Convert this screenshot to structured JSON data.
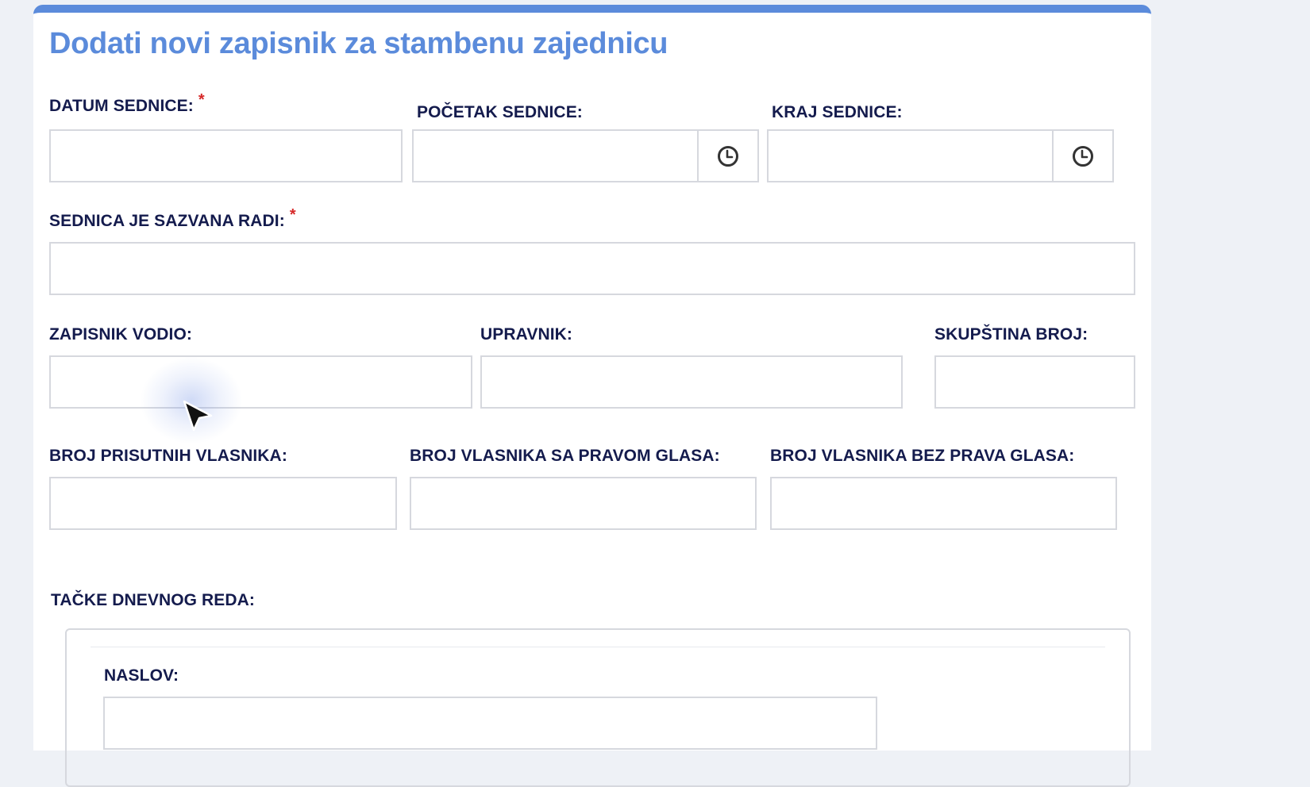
{
  "form": {
    "title": "Dodati novi zapisnik za stambenu zajednicu",
    "required_mark": "*",
    "fields": {
      "datum_sednice": {
        "label": "DATUM SEDNICE:",
        "value": ""
      },
      "pocetak_sednice": {
        "label": "POČETAK SEDNICE:",
        "value": ""
      },
      "kraj_sednice": {
        "label": "KRAJ SEDNICE:",
        "value": ""
      },
      "sednica_sazvana_radi": {
        "label": "SEDNICA JE SAZVANA RADI:",
        "value": ""
      },
      "zapisnik_vodio": {
        "label": "ZAPISNIK VODIO:",
        "value": ""
      },
      "upravnik": {
        "label": "UPRAVNIK:",
        "value": ""
      },
      "skupstina_broj": {
        "label": "SKUPŠTINA BROJ:",
        "value": ""
      },
      "broj_prisutnih": {
        "label": "BROJ PRISUTNIH VLASNIKA:",
        "value": ""
      },
      "broj_sa_pravom": {
        "label": "BROJ VLASNIKA SA PRAVOM GLASA:",
        "value": ""
      },
      "broj_bez_prava": {
        "label": "BROJ VLASNIKA BEZ PRAVA GLASA:",
        "value": ""
      }
    },
    "agenda": {
      "label": "TAČKE DNEVNOG REDA:",
      "item": {
        "naslov_label": "NASLOV:",
        "naslov_value": ""
      }
    }
  },
  "icons": {
    "time_picker": "clock-icon",
    "pointer": "mouse-cursor-icon"
  },
  "colors": {
    "accent": "#5b8bdb",
    "label": "#141b4d",
    "required": "#d62828",
    "border": "#d6d8de"
  }
}
